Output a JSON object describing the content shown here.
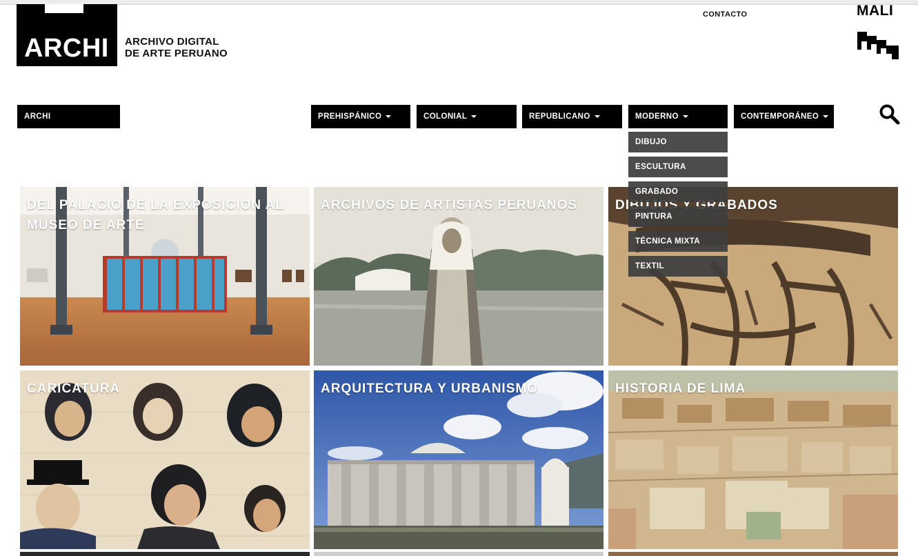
{
  "header": {
    "logo_text": "ARCHI",
    "logo_subtitle_line1": "ARCHIVO DIGITAL",
    "logo_subtitle_line2": "DE ARTE PERUANO",
    "contact_label": "CONTACTO",
    "partner_logo_text": "MALI"
  },
  "nav": {
    "home_label": "ARCHI",
    "items": [
      {
        "label": "PREHISPÁNICO"
      },
      {
        "label": "COLONIAL"
      },
      {
        "label": "REPUBLICANO"
      },
      {
        "label": "MODERNO"
      },
      {
        "label": "CONTEMPORÁNEO"
      }
    ],
    "search_icon": "search-icon"
  },
  "dropdown": {
    "parent": "MODERNO",
    "items": [
      {
        "label": "DIBUJO"
      },
      {
        "label": "ESCULTURA"
      },
      {
        "label": "GRABADO"
      },
      {
        "label": "PINTURA"
      },
      {
        "label": "TÉCNICA MIXTA"
      },
      {
        "label": "TEXTIL"
      }
    ]
  },
  "tiles": [
    {
      "title": "DEL PALACIO DE LA EXPOSICION AL MUSEO DE ARTE"
    },
    {
      "title": "ARCHIVOS DE ARTISTAS PERUANOS"
    },
    {
      "title": "DIBUJOS Y GRABADOS"
    },
    {
      "title": "CARICATURA"
    },
    {
      "title": "ARQUITECTURA Y URBANISMO"
    },
    {
      "title": "HISTORIA DE LIMA"
    }
  ],
  "colors": {
    "nav_background": "#000000",
    "dropdown_background": "#3e3e3e",
    "text_on_dark": "#ffffff"
  }
}
